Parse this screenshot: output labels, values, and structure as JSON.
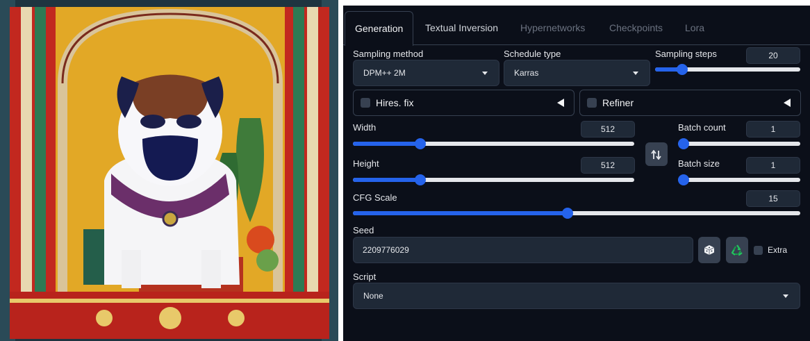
{
  "tabs": [
    {
      "label": "Generation",
      "active": true
    },
    {
      "label": "Textual Inversion",
      "active": false
    },
    {
      "label": "Hypernetworks",
      "active": false
    },
    {
      "label": "Checkpoints",
      "active": false
    },
    {
      "label": "Lora",
      "active": false
    }
  ],
  "sampling": {
    "method_label": "Sampling method",
    "method_value": "DPM++ 2M",
    "schedule_label": "Schedule type",
    "schedule_value": "Karras",
    "steps_label": "Sampling steps",
    "steps_value": "20",
    "steps_fraction": 0.16
  },
  "hires": {
    "label": "Hires. fix",
    "checked": false
  },
  "refiner": {
    "label": "Refiner",
    "checked": false
  },
  "width": {
    "label": "Width",
    "value": "512",
    "fraction": 0.23
  },
  "height": {
    "label": "Height",
    "value": "512",
    "fraction": 0.23
  },
  "batch_count": {
    "label": "Batch count",
    "value": "1",
    "fraction": 0.0
  },
  "batch_size": {
    "label": "Batch size",
    "value": "1",
    "fraction": 0.0
  },
  "cfg": {
    "label": "CFG Scale",
    "value": "15",
    "fraction": 0.48
  },
  "seed": {
    "label": "Seed",
    "value": "2209776029",
    "extra_label": "Extra",
    "extra_checked": false
  },
  "script": {
    "label": "Script",
    "value": "None"
  },
  "icons": {
    "swap": "swap-dimensions-icon",
    "dice": "dice-icon",
    "recycle": "recycle-icon"
  },
  "colors": {
    "panel_bg": "#0b0f19",
    "accent": "#2563eb",
    "input_bg": "#1f2937",
    "recycle_green": "#22c55e"
  }
}
